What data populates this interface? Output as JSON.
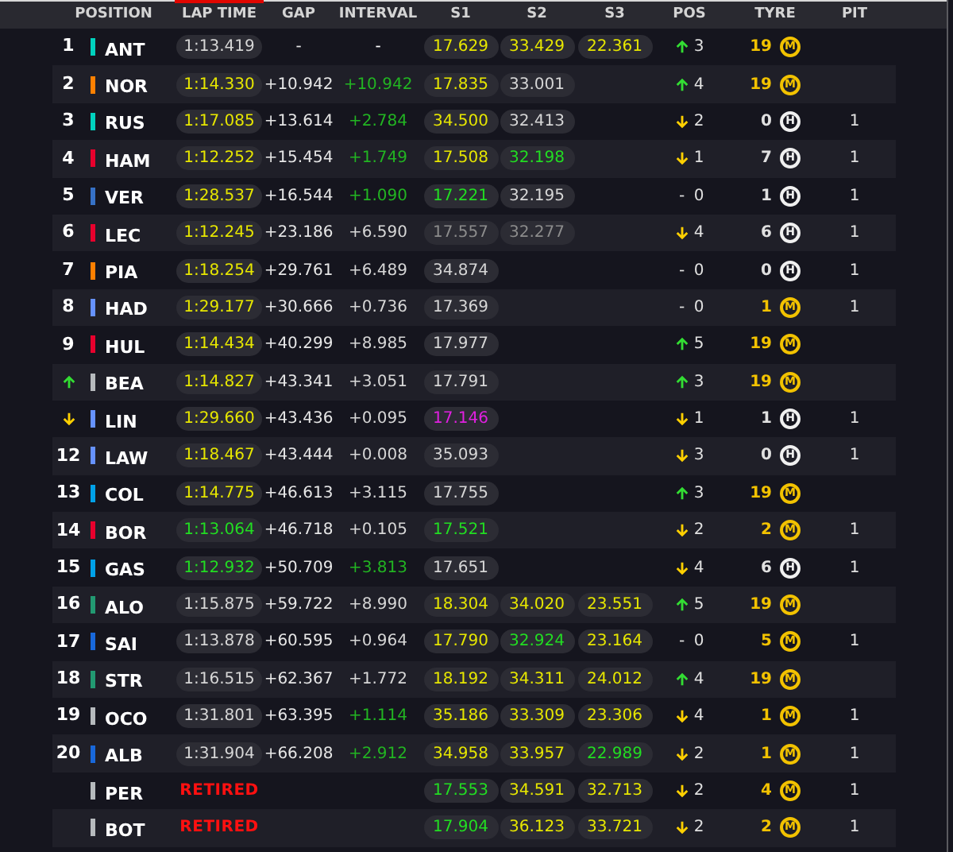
{
  "columns": [
    {
      "label": "POSITION",
      "selected": false
    },
    {
      "label": "LAP TIME",
      "selected": true
    },
    {
      "label": "GAP",
      "selected": false
    },
    {
      "label": "INTERVAL",
      "selected": false
    },
    {
      "label": "S1",
      "selected": false
    },
    {
      "label": "S2",
      "selected": false
    },
    {
      "label": "S3",
      "selected": false
    },
    {
      "label": "POS",
      "selected": false
    },
    {
      "label": "TYRE",
      "selected": false
    },
    {
      "label": "PIT",
      "selected": false
    }
  ],
  "rows": [
    {
      "position": {
        "kind": "number",
        "text": "1"
      },
      "color": "#00d2be",
      "code": "ANT",
      "lap_time": {
        "kind": "time",
        "text": "1:13.419",
        "color": "#d6d6d6"
      },
      "gap": "-",
      "interval": {
        "text": "-",
        "color": "#ffffff"
      },
      "s1": {
        "text": "17.629",
        "color": "#e6e600"
      },
      "s2": {
        "text": "33.429",
        "color": "#e6e600"
      },
      "s3": {
        "text": "22.361",
        "color": "#e6e600"
      },
      "pos_change": {
        "kind": "up",
        "value": "3"
      },
      "tyre": {
        "laps": "19",
        "letter": "M",
        "kind": "medium"
      }
    },
    {
      "position": {
        "kind": "number",
        "text": "2"
      },
      "color": "#ff8000",
      "code": "NOR",
      "lap_time": {
        "kind": "time",
        "text": "1:14.330",
        "color": "#e6e600"
      },
      "gap": "+10.942",
      "interval": {
        "text": "+10.942",
        "color": "#22b422"
      },
      "s1": {
        "text": "17.835",
        "color": "#e6e600"
      },
      "s2": {
        "text": "33.001",
        "color": "#d6d6d6"
      },
      "pos_change": {
        "kind": "up",
        "value": "4"
      },
      "tyre": {
        "laps": "19",
        "letter": "M",
        "kind": "medium"
      }
    },
    {
      "position": {
        "kind": "number",
        "text": "3"
      },
      "color": "#00d2be",
      "code": "RUS",
      "lap_time": {
        "kind": "time",
        "text": "1:17.085",
        "color": "#e6e600"
      },
      "gap": "+13.614",
      "interval": {
        "text": "+2.784",
        "color": "#22b422"
      },
      "s1": {
        "text": "34.500",
        "color": "#e6e600"
      },
      "s2": {
        "text": "32.413",
        "color": "#d6d6d6"
      },
      "pos_change": {
        "kind": "down",
        "value": "2"
      },
      "tyre": {
        "laps": "0",
        "letter": "H",
        "kind": "hard"
      },
      "pit": "1"
    },
    {
      "position": {
        "kind": "number",
        "text": "4"
      },
      "color": "#e8002d",
      "code": "HAM",
      "lap_time": {
        "kind": "time",
        "text": "1:12.252",
        "color": "#e6e600"
      },
      "gap": "+15.454",
      "interval": {
        "text": "+1.749",
        "color": "#22b422"
      },
      "s1": {
        "text": "17.508",
        "color": "#e6e600"
      },
      "s2": {
        "text": "32.198",
        "color": "#22dd22"
      },
      "pos_change": {
        "kind": "down",
        "value": "1"
      },
      "tyre": {
        "laps": "7",
        "letter": "H",
        "kind": "hard"
      },
      "pit": "1"
    },
    {
      "position": {
        "kind": "number",
        "text": "5"
      },
      "color": "#3671c6",
      "code": "VER",
      "lap_time": {
        "kind": "time",
        "text": "1:28.537",
        "color": "#e6e600"
      },
      "gap": "+16.544",
      "interval": {
        "text": "+1.090",
        "color": "#22b422"
      },
      "s1": {
        "text": "17.221",
        "color": "#22dd22"
      },
      "s2": {
        "text": "32.195",
        "color": "#d6d6d6"
      },
      "pos_change": {
        "kind": "none",
        "symbol": "-",
        "value": "0"
      },
      "tyre": {
        "laps": "1",
        "letter": "H",
        "kind": "hard"
      },
      "pit": "1"
    },
    {
      "position": {
        "kind": "number",
        "text": "6"
      },
      "color": "#e8002d",
      "code": "LEC",
      "lap_time": {
        "kind": "time",
        "text": "1:12.245",
        "color": "#e6e600"
      },
      "gap": "+23.186",
      "interval": {
        "text": "+6.590",
        "color": "#d6d6d6"
      },
      "s1": {
        "text": "17.557",
        "color": "#8c8c8c"
      },
      "s2": {
        "text": "32.277",
        "color": "#8c8c8c"
      },
      "pos_change": {
        "kind": "down",
        "value": "4"
      },
      "tyre": {
        "laps": "6",
        "letter": "H",
        "kind": "hard"
      },
      "pit": "1"
    },
    {
      "position": {
        "kind": "number",
        "text": "7"
      },
      "color": "#ff8000",
      "code": "PIA",
      "lap_time": {
        "kind": "time",
        "text": "1:18.254",
        "color": "#e6e600"
      },
      "gap": "+29.761",
      "interval": {
        "text": "+6.489",
        "color": "#d6d6d6"
      },
      "s1": {
        "text": "34.874",
        "color": "#d6d6d6"
      },
      "pos_change": {
        "kind": "none",
        "symbol": "-",
        "value": "0"
      },
      "tyre": {
        "laps": "0",
        "letter": "H",
        "kind": "hard"
      },
      "pit": "1"
    },
    {
      "position": {
        "kind": "number",
        "text": "8"
      },
      "color": "#6692ff",
      "code": "HAD",
      "lap_time": {
        "kind": "time",
        "text": "1:29.177",
        "color": "#e6e600"
      },
      "gap": "+30.666",
      "interval": {
        "text": "+0.736",
        "color": "#d6d6d6"
      },
      "s1": {
        "text": "17.369",
        "color": "#d6d6d6"
      },
      "pos_change": {
        "kind": "none",
        "symbol": "-",
        "value": "0"
      },
      "tyre": {
        "laps": "1",
        "letter": "M",
        "kind": "medium"
      },
      "pit": "1"
    },
    {
      "position": {
        "kind": "number",
        "text": "9"
      },
      "color": "#e8002d",
      "code": "HUL",
      "lap_time": {
        "kind": "time",
        "text": "1:14.434",
        "color": "#e6e600"
      },
      "gap": "+40.299",
      "interval": {
        "text": "+8.985",
        "color": "#d6d6d6"
      },
      "s1": {
        "text": "17.977",
        "color": "#d6d6d6"
      },
      "pos_change": {
        "kind": "up",
        "value": "5"
      },
      "tyre": {
        "laps": "19",
        "letter": "M",
        "kind": "medium"
      }
    },
    {
      "position": {
        "kind": "up"
      },
      "color": "#b6babd",
      "code": "BEA",
      "lap_time": {
        "kind": "time",
        "text": "1:14.827",
        "color": "#e6e600"
      },
      "gap": "+43.341",
      "interval": {
        "text": "+3.051",
        "color": "#d6d6d6"
      },
      "s1": {
        "text": "17.791",
        "color": "#d6d6d6"
      },
      "pos_change": {
        "kind": "up",
        "value": "3"
      },
      "tyre": {
        "laps": "19",
        "letter": "M",
        "kind": "medium"
      }
    },
    {
      "position": {
        "kind": "down"
      },
      "color": "#6692ff",
      "code": "LIN",
      "lap_time": {
        "kind": "time",
        "text": "1:29.660",
        "color": "#e6e600"
      },
      "gap": "+43.436",
      "interval": {
        "text": "+0.095",
        "color": "#d6d6d6"
      },
      "s1": {
        "text": "17.146",
        "color": "#e020e0"
      },
      "pos_change": {
        "kind": "down",
        "value": "1"
      },
      "tyre": {
        "laps": "1",
        "letter": "H",
        "kind": "hard"
      },
      "pit": "1"
    },
    {
      "position": {
        "kind": "number",
        "text": "12"
      },
      "color": "#6692ff",
      "code": "LAW",
      "lap_time": {
        "kind": "time",
        "text": "1:18.467",
        "color": "#e6e600"
      },
      "gap": "+43.444",
      "interval": {
        "text": "+0.008",
        "color": "#d6d6d6"
      },
      "s1": {
        "text": "35.093",
        "color": "#d6d6d6"
      },
      "pos_change": {
        "kind": "down",
        "value": "3"
      },
      "tyre": {
        "laps": "0",
        "letter": "H",
        "kind": "hard"
      },
      "pit": "1"
    },
    {
      "position": {
        "kind": "number",
        "text": "13"
      },
      "color": "#00a1e8",
      "code": "COL",
      "lap_time": {
        "kind": "time",
        "text": "1:14.775",
        "color": "#e6e600"
      },
      "gap": "+46.613",
      "interval": {
        "text": "+3.115",
        "color": "#d6d6d6"
      },
      "s1": {
        "text": "17.755",
        "color": "#d6d6d6"
      },
      "pos_change": {
        "kind": "up",
        "value": "3"
      },
      "tyre": {
        "laps": "19",
        "letter": "M",
        "kind": "medium"
      }
    },
    {
      "position": {
        "kind": "number",
        "text": "14"
      },
      "color": "#e8002d",
      "code": "BOR",
      "lap_time": {
        "kind": "time",
        "text": "1:13.064",
        "color": "#22dd22"
      },
      "gap": "+46.718",
      "interval": {
        "text": "+0.105",
        "color": "#d6d6d6"
      },
      "s1": {
        "text": "17.521",
        "color": "#22dd22"
      },
      "pos_change": {
        "kind": "down",
        "value": "2"
      },
      "tyre": {
        "laps": "2",
        "letter": "M",
        "kind": "medium"
      },
      "pit": "1"
    },
    {
      "position": {
        "kind": "number",
        "text": "15"
      },
      "color": "#00a1e8",
      "code": "GAS",
      "lap_time": {
        "kind": "time",
        "text": "1:12.932",
        "color": "#22dd22"
      },
      "gap": "+50.709",
      "interval": {
        "text": "+3.813",
        "color": "#22b422"
      },
      "s1": {
        "text": "17.651",
        "color": "#d6d6d6"
      },
      "pos_change": {
        "kind": "down",
        "value": "4"
      },
      "tyre": {
        "laps": "6",
        "letter": "H",
        "kind": "hard"
      },
      "pit": "1"
    },
    {
      "position": {
        "kind": "number",
        "text": "16"
      },
      "color": "#229971",
      "code": "ALO",
      "lap_time": {
        "kind": "time",
        "text": "1:15.875",
        "color": "#d6d6d6"
      },
      "gap": "+59.722",
      "interval": {
        "text": "+8.990",
        "color": "#d6d6d6"
      },
      "s1": {
        "text": "18.304",
        "color": "#e6e600"
      },
      "s2": {
        "text": "34.020",
        "color": "#e6e600"
      },
      "s3": {
        "text": "23.551",
        "color": "#e6e600"
      },
      "pos_change": {
        "kind": "up",
        "value": "5"
      },
      "tyre": {
        "laps": "19",
        "letter": "M",
        "kind": "medium"
      }
    },
    {
      "position": {
        "kind": "number",
        "text": "17"
      },
      "color": "#1868db",
      "code": "SAI",
      "lap_time": {
        "kind": "time",
        "text": "1:13.878",
        "color": "#d6d6d6"
      },
      "gap": "+60.595",
      "interval": {
        "text": "+0.964",
        "color": "#d6d6d6"
      },
      "s1": {
        "text": "17.790",
        "color": "#e6e600"
      },
      "s2": {
        "text": "32.924",
        "color": "#22dd22"
      },
      "s3": {
        "text": "23.164",
        "color": "#e6e600"
      },
      "pos_change": {
        "kind": "none",
        "symbol": "-",
        "value": "0"
      },
      "tyre": {
        "laps": "5",
        "letter": "M",
        "kind": "medium"
      },
      "pit": "1"
    },
    {
      "position": {
        "kind": "number",
        "text": "18"
      },
      "color": "#229971",
      "code": "STR",
      "lap_time": {
        "kind": "time",
        "text": "1:16.515",
        "color": "#d6d6d6"
      },
      "gap": "+62.367",
      "interval": {
        "text": "+1.772",
        "color": "#d6d6d6"
      },
      "s1": {
        "text": "18.192",
        "color": "#e6e600"
      },
      "s2": {
        "text": "34.311",
        "color": "#e6e600"
      },
      "s3": {
        "text": "24.012",
        "color": "#e6e600"
      },
      "pos_change": {
        "kind": "up",
        "value": "4"
      },
      "tyre": {
        "laps": "19",
        "letter": "M",
        "kind": "medium"
      }
    },
    {
      "position": {
        "kind": "number",
        "text": "19"
      },
      "color": "#b6babd",
      "code": "OCO",
      "lap_time": {
        "kind": "time",
        "text": "1:31.801",
        "color": "#d6d6d6"
      },
      "gap": "+63.395",
      "interval": {
        "text": "+1.114",
        "color": "#22b422"
      },
      "s1": {
        "text": "35.186",
        "color": "#e6e600"
      },
      "s2": {
        "text": "33.309",
        "color": "#e6e600"
      },
      "s3": {
        "text": "23.306",
        "color": "#e6e600"
      },
      "pos_change": {
        "kind": "down",
        "value": "4"
      },
      "tyre": {
        "laps": "1",
        "letter": "M",
        "kind": "medium"
      },
      "pit": "1"
    },
    {
      "position": {
        "kind": "number",
        "text": "20"
      },
      "color": "#1868db",
      "code": "ALB",
      "lap_time": {
        "kind": "time",
        "text": "1:31.904",
        "color": "#d6d6d6"
      },
      "gap": "+66.208",
      "interval": {
        "text": "+2.912",
        "color": "#22b422"
      },
      "s1": {
        "text": "34.958",
        "color": "#e6e600"
      },
      "s2": {
        "text": "33.957",
        "color": "#e6e600"
      },
      "s3": {
        "text": "22.989",
        "color": "#22dd22"
      },
      "pos_change": {
        "kind": "down",
        "value": "2"
      },
      "tyre": {
        "laps": "1",
        "letter": "M",
        "kind": "medium"
      },
      "pit": "1"
    },
    {
      "position": {
        "kind": "none"
      },
      "color": "#b6babd",
      "code": "PER",
      "lap_time": {
        "kind": "retired",
        "text": "RETIRED",
        "color": "#ff1010"
      },
      "s1": {
        "text": "17.553",
        "color": "#22dd22"
      },
      "s2": {
        "text": "34.591",
        "color": "#e6e600"
      },
      "s3": {
        "text": "32.713",
        "color": "#e6e600"
      },
      "pos_change": {
        "kind": "down",
        "value": "2"
      },
      "tyre": {
        "laps": "4",
        "letter": "M",
        "kind": "medium"
      },
      "pit": "1"
    },
    {
      "position": {
        "kind": "none"
      },
      "color": "#b6babd",
      "code": "BOT",
      "lap_time": {
        "kind": "retired",
        "text": "RETIRED",
        "color": "#ff1010"
      },
      "s1": {
        "text": "17.904",
        "color": "#22dd22"
      },
      "s2": {
        "text": "36.123",
        "color": "#e6e600"
      },
      "s3": {
        "text": "33.721",
        "color": "#e6e600"
      },
      "pos_change": {
        "kind": "down",
        "value": "2"
      },
      "tyre": {
        "laps": "2",
        "letter": "M",
        "kind": "medium"
      },
      "pit": "1"
    }
  ]
}
